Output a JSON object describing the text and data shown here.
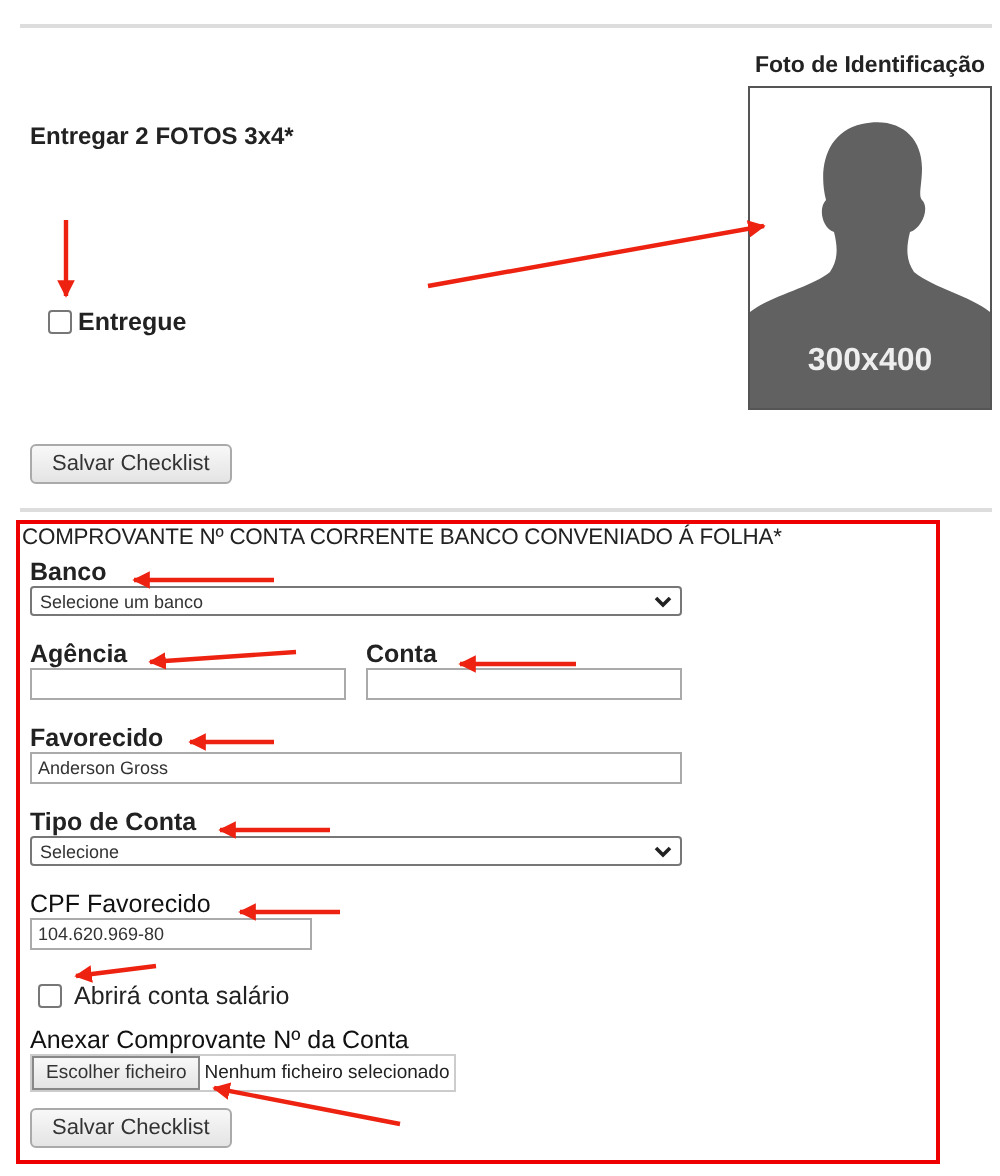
{
  "photo_section": {
    "instruction": "Entregar 2 FOTOS 3x4*",
    "photo_title": "Foto de Identificação",
    "photo_placeholder": "300x400",
    "delivered": {
      "label": "Entregue",
      "checked": false
    },
    "save_button": "Salvar Checklist"
  },
  "bank_section": {
    "title": "COMPROVANTE Nº CONTA CORRENTE BANCO CONVENIADO Á FOLHA*",
    "rows": [
      [
        {
          "kind": "select",
          "label": "Banco",
          "value": "Selecione um banco"
        }
      ],
      [
        {
          "kind": "text",
          "label": "Agência"
        },
        {
          "kind": "text",
          "label": "Conta"
        }
      ],
      [
        {
          "kind": "text",
          "label": "Favorecido",
          "value": "Anderson Gross"
        }
      ],
      [
        {
          "kind": "select",
          "label": "Tipo de Conta",
          "value": "Selecione"
        }
      ],
      [
        {
          "kind": "short_text",
          "label": "CPF Favorecido",
          "value": "104.620.969-80"
        }
      ]
    ],
    "salary_account": {
      "label": "Abrirá conta salário",
      "checked": false
    },
    "attachment": {
      "label": "Anexar Comprovante Nº da Conta",
      "button": "Escolher ficheiro",
      "status": "Nenhum ficheiro selecionado"
    },
    "save_button": "Salvar Checklist"
  }
}
